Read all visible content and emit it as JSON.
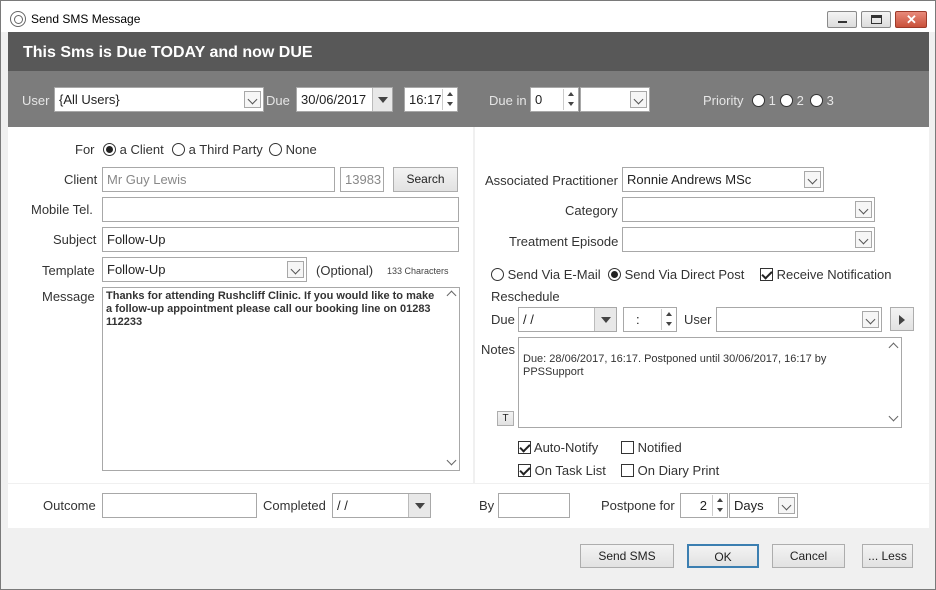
{
  "window": {
    "title": "Send SMS Message"
  },
  "banner": {
    "text": "This Sms is Due TODAY and now DUE"
  },
  "filter": {
    "user_label": "User",
    "user_value": "{All Users}",
    "due_label": "Due",
    "due_date": "30/06/2017",
    "due_time": "16:17",
    "due_in_label": "Due in",
    "due_in_value": "0",
    "due_in_unit": "",
    "priority_label": "Priority",
    "priority_options": [
      "1",
      "2",
      "3"
    ]
  },
  "form": {
    "for_label": "For",
    "for_options": [
      "a Client",
      "a Third Party",
      "None"
    ],
    "for_selected": "a Client",
    "client_label": "Client",
    "client_name": "Mr Guy Lewis",
    "client_id": "13983",
    "search_button": "Search",
    "mobile_label": "Mobile Tel.",
    "mobile_value": "",
    "subject_label": "Subject",
    "subject_value": "Follow-Up",
    "template_label": "Template",
    "template_value": "Follow-Up",
    "optional_text": "(Optional)",
    "char_count": "133 Characters",
    "message_label": "Message",
    "message_text": "Thanks for attending Rushcliff Clinic. If you would like to make a follow-up appointment please call our booking line on 01283 112233"
  },
  "right": {
    "practitioner_label": "Associated Practitioner",
    "practitioner_value": "Ronnie Andrews MSc",
    "category_label": "Category",
    "category_value": "",
    "episode_label": "Treatment Episode",
    "episode_value": "",
    "send_email_label": "Send Via E-Mail",
    "send_post_label": "Send Via Direct Post",
    "receive_notification_label": "Receive Notification",
    "reschedule_label": "Reschedule",
    "due_label": "Due",
    "due_date": " /  /",
    "due_time": ":",
    "user_label": "User",
    "user_value": "",
    "notes_label": "Notes",
    "notes_t": "T",
    "notes_text": "Due: 28/06/2017, 16:17. Postponed until 30/06/2017, 16:17 by PPSSupport",
    "auto_notify_label": "Auto-Notify",
    "notified_label": "Notified",
    "on_task_list_label": "On Task List",
    "on_diary_print_label": "On Diary Print"
  },
  "bottom": {
    "outcome_label": "Outcome",
    "outcome_value": "",
    "completed_label": "Completed",
    "completed_value": " /  /",
    "by_label": "By",
    "by_value": "",
    "postpone_label": "Postpone for",
    "postpone_value": "2",
    "postpone_unit": "Days"
  },
  "buttons": {
    "send_sms": "Send SMS",
    "ok": "OK",
    "cancel": "Cancel",
    "less": "... Less"
  }
}
